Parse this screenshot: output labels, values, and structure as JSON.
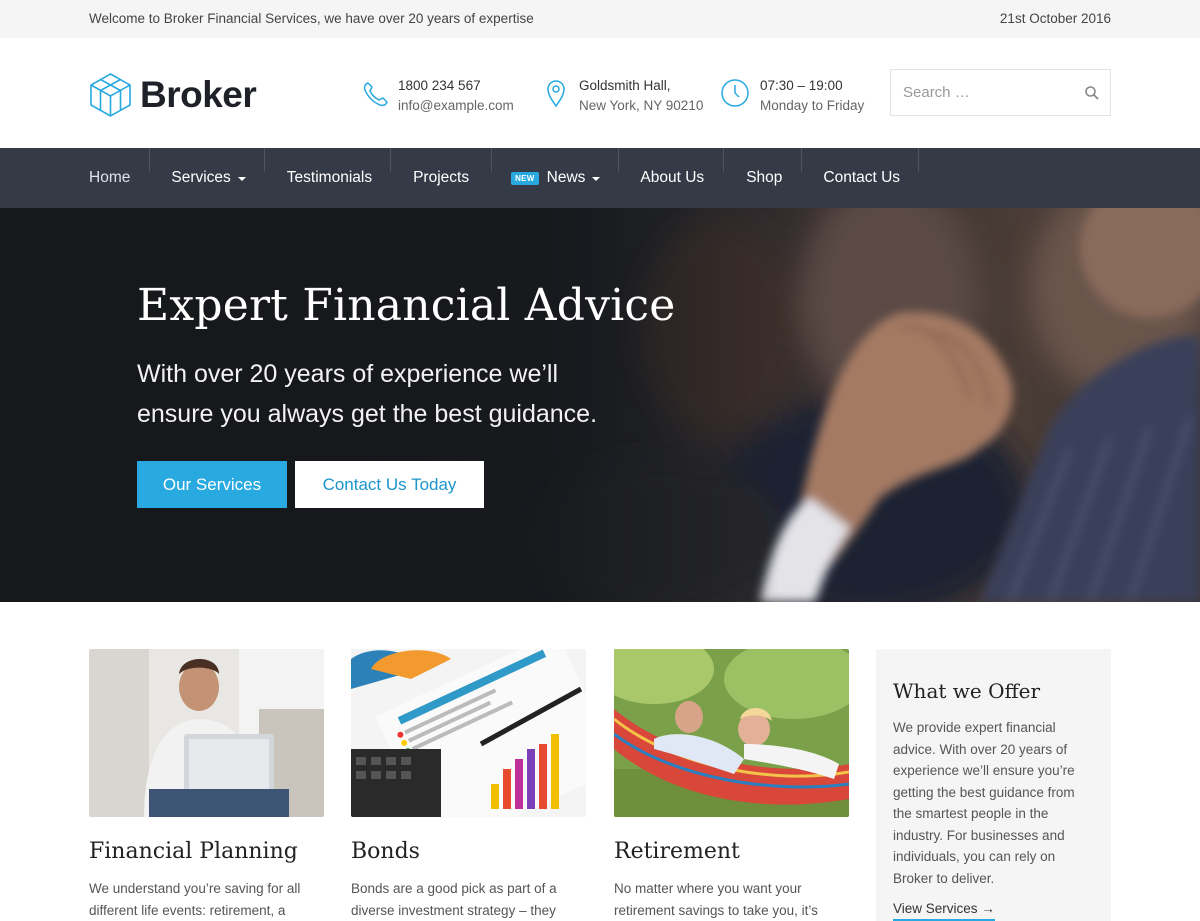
{
  "topbar": {
    "welcome": "Welcome to Broker Financial Services, we have over 20 years of expertise",
    "date": "21st October 2016"
  },
  "header": {
    "logo_text": "Broker",
    "phone": "1800 234 567",
    "email": "info@example.com",
    "address_line1": "Goldsmith Hall,",
    "address_line2": "New York, NY 90210",
    "hours": "07:30 – 19:00",
    "days": "Monday to Friday",
    "search_placeholder": "Search …"
  },
  "nav": {
    "items": [
      {
        "label": "Home"
      },
      {
        "label": "Services"
      },
      {
        "label": "Testimonials"
      },
      {
        "label": "Projects"
      },
      {
        "label": "News",
        "badge": "NEW"
      },
      {
        "label": "About Us"
      },
      {
        "label": "Shop"
      },
      {
        "label": "Contact Us"
      }
    ]
  },
  "hero": {
    "title": "Expert Financial Advice",
    "subtitle": "With over 20 years of experience we’ll ensure you always get the best guidance.",
    "primary_button": "Our Services",
    "secondary_button": "Contact Us Today"
  },
  "cards": [
    {
      "title": "Financial Planning",
      "text": "We understand you’re saving for all different life events: retirement, a house"
    },
    {
      "title": "Bonds",
      "text": "Bonds are a good pick as part of a diverse investment strategy – they offer"
    },
    {
      "title": "Retirement",
      "text": "No matter where you want your retirement savings to take you, it’s quick"
    }
  ],
  "offer": {
    "title": "What we Offer",
    "text": "We provide expert financial advice. With over 20 years of experience we’ll ensure you’re getting the best guidance from the smartest people in the industry. For businesses and individuals, you can rely on Broker to deliver.",
    "link": "View Services →"
  },
  "colors": {
    "accent": "#28a9e0",
    "nav_bg": "#353a47",
    "topbar_bg": "#f5f5f5"
  }
}
